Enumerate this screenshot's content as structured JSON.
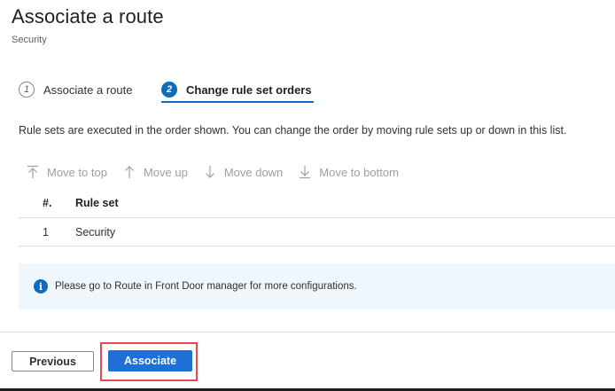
{
  "header": {
    "title": "Associate a route",
    "subtitle": "Security"
  },
  "steps": [
    {
      "number": "1",
      "label": "Associate a route",
      "active": false
    },
    {
      "number": "2",
      "label": "Change rule set orders",
      "active": true
    }
  ],
  "description": "Rule sets are executed in the order shown. You can change the order by moving rule sets up or down in this list.",
  "toolbar": {
    "move_to_top": "Move to top",
    "move_up": "Move up",
    "move_down": "Move down",
    "move_to_bottom": "Move to bottom"
  },
  "table": {
    "columns": [
      "#.",
      "Rule set"
    ],
    "rows": [
      {
        "num": "1",
        "rule_set": "Security"
      }
    ]
  },
  "info": {
    "icon": "info-icon",
    "text": "Please go to Route in Front Door manager for more configurations."
  },
  "footer": {
    "previous_label": "Previous",
    "associate_label": "Associate"
  },
  "colors": {
    "accent": "#0f6cbd",
    "primary_button": "#1f6fd6",
    "highlight_outline": "#e74856",
    "info_background": "#eff6fc"
  }
}
